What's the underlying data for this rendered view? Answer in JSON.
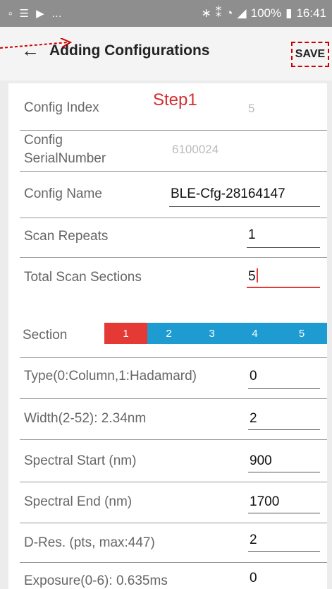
{
  "status_bar": {
    "left_icons": [
      "image-icon",
      "list-icon",
      "play-store-icon",
      "more-dots-icon"
    ],
    "right_icons": [
      "bluetooth-icon",
      "vibrate-icon",
      "wifi-icon",
      "signal-icon",
      "battery-icon"
    ],
    "battery": "100%",
    "time": "16:41"
  },
  "app_bar": {
    "title": "Adding Configurations",
    "save_label": "SAVE"
  },
  "annotation": {
    "step": "Step1"
  },
  "form": {
    "config_index": {
      "label": "Config Index",
      "value": "5"
    },
    "serial_number": {
      "label_line1": "Config",
      "label_line2": "SerialNumber",
      "value": "6100024"
    },
    "config_name": {
      "label": "Config Name",
      "value": "BLE-Cfg-28164147"
    },
    "scan_repeats": {
      "label": "Scan Repeats",
      "value": "1"
    },
    "total_sections": {
      "label": "Total Scan Sections",
      "value": "5"
    }
  },
  "section": {
    "label": "Section",
    "tabs": [
      "1",
      "2",
      "3",
      "4",
      "5"
    ],
    "selected_index": 0,
    "selected_color": "#e53935",
    "tab_color": "#1e9bd0"
  },
  "section_fields": [
    {
      "label": "Type(0:Column,1:Hadamard)",
      "value": "0"
    },
    {
      "label": "Width(2-52): 2.34nm",
      "value": "2"
    },
    {
      "label": "Spectral Start (nm)",
      "value": "900"
    },
    {
      "label": "Spectral End (nm)",
      "value": "1700"
    },
    {
      "label": "D-Res. (pts, max:447)",
      "value": "2"
    },
    {
      "label": "Exposure(0-6): 0.635ms",
      "value": "0"
    }
  ]
}
